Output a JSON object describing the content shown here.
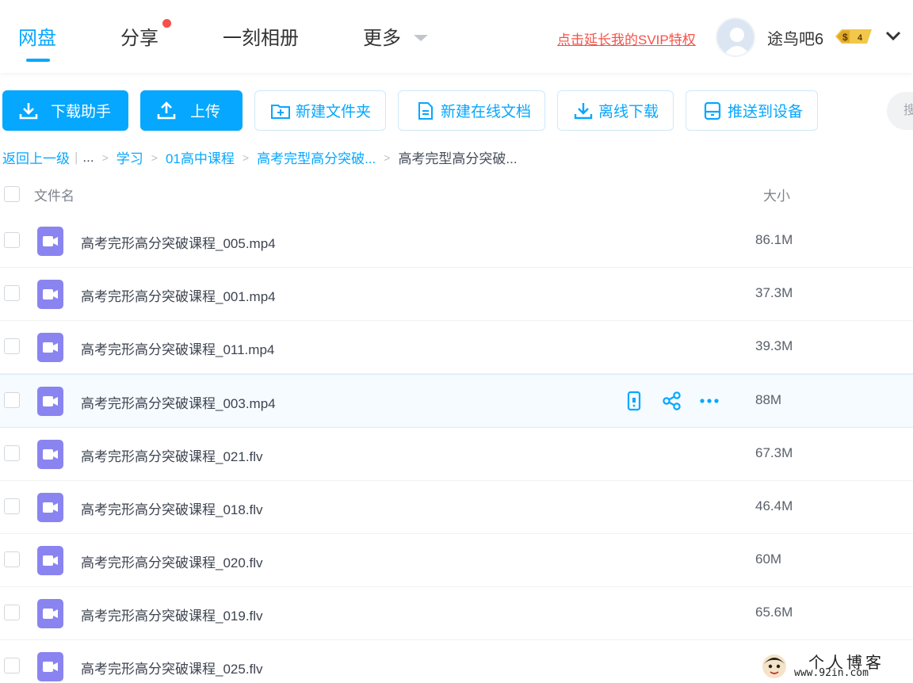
{
  "nav": {
    "tabs": [
      {
        "label": "网盘",
        "active": true
      },
      {
        "label": "分享",
        "has_notification_dot": true
      },
      {
        "label": "一刻相册"
      },
      {
        "label": "更多",
        "has_dropdown": true
      }
    ],
    "svip_link": "点击延长我的SVIP特权",
    "username": "途鸟吧6",
    "vip_badge": {
      "symbol": "$",
      "level": "4"
    }
  },
  "toolbar": {
    "download_helper": "下载助手",
    "upload": "上传",
    "new_folder": "新建文件夹",
    "new_online_doc": "新建在线文档",
    "offline_download": "离线下载",
    "push_to_device": "推送到设备",
    "search_partial": "搜"
  },
  "breadcrumb": {
    "back": "返回上一级",
    "pipe": "|",
    "ellipsis": "...",
    "items": [
      "学习",
      "01高中课程",
      "高考完型高分突破..."
    ],
    "current": "高考完型高分突破..."
  },
  "table": {
    "header_name": "文件名",
    "header_size": "大小",
    "rows": [
      {
        "name": "高考完形高分突破课程_005.mp4",
        "size": "86.1M"
      },
      {
        "name": "高考完形高分突破课程_001.mp4",
        "size": "37.3M"
      },
      {
        "name": "高考完形高分突破课程_011.mp4",
        "size": "39.3M"
      },
      {
        "name": "高考完形高分突破课程_003.mp4",
        "size": "88M",
        "hover": true
      },
      {
        "name": "高考完形高分突破课程_021.flv",
        "size": "67.3M"
      },
      {
        "name": "高考完形高分突破课程_018.flv",
        "size": "46.4M"
      },
      {
        "name": "高考完形高分突破课程_020.flv",
        "size": "60M"
      },
      {
        "name": "高考完形高分突破课程_019.flv",
        "size": "65.6M"
      },
      {
        "name": "高考完形高分突破课程_025.flv",
        "size": ""
      }
    ],
    "hover_actions": [
      "push-to-phone-icon",
      "share-icon",
      "more-icon"
    ]
  },
  "watermark": {
    "title": "个人博客",
    "url": "www.92in.com"
  },
  "colors": {
    "accent": "#06a7ff",
    "danger": "#f5514a",
    "video_icon": "#8a84f0"
  }
}
